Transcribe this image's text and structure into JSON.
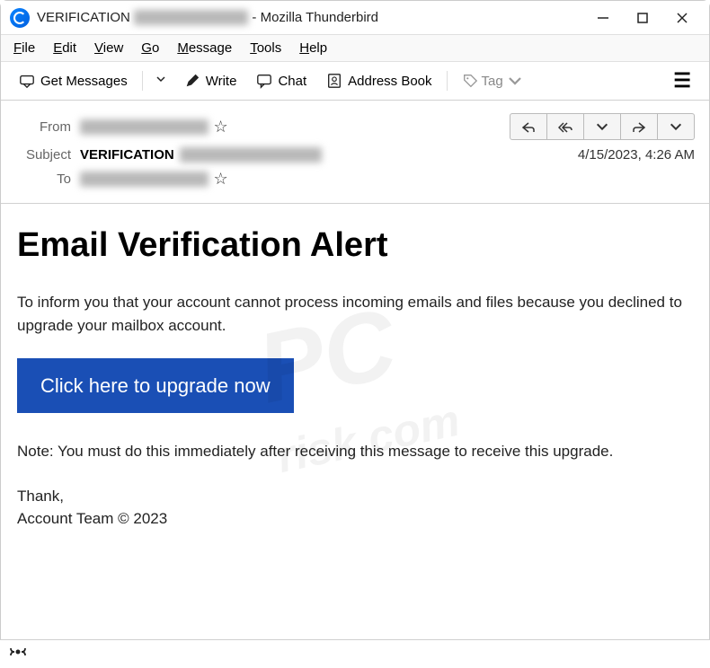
{
  "window": {
    "title_prefix": "VERIFICATION",
    "title_suffix": "- Mozilla Thunderbird"
  },
  "menubar": [
    "File",
    "Edit",
    "View",
    "Go",
    "Message",
    "Tools",
    "Help"
  ],
  "toolbar": {
    "get_messages": "Get Messages",
    "write": "Write",
    "chat": "Chat",
    "address_book": "Address Book",
    "tag": "Tag"
  },
  "headers": {
    "from_label": "From",
    "subject_label": "Subject",
    "to_label": "To",
    "subject_value": "VERIFICATION",
    "date": "4/15/2023, 4:26 AM"
  },
  "body": {
    "title": "Email Verification Alert",
    "para1": "To inform you that your account cannot process incoming emails and files because you declined to upgrade your mailbox account.",
    "button": "Click here to upgrade now",
    "note": "Note: You must do this immediately after receiving this message to receive this upgrade.",
    "thank": "Thank,",
    "signature": "Account Team  © 2023"
  },
  "watermark": {
    "line1": "PC",
    "line2": "risk.com"
  }
}
